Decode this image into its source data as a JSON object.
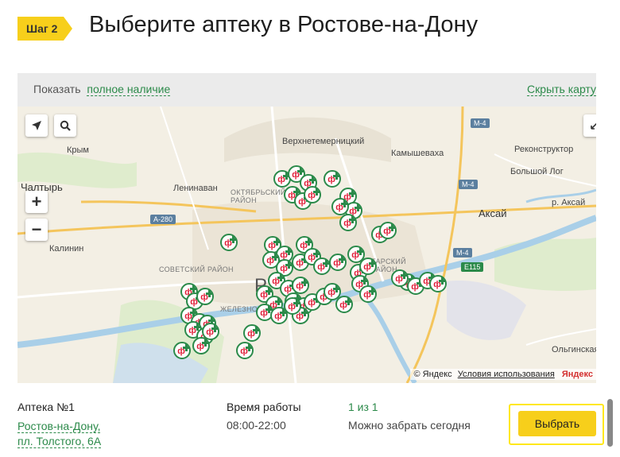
{
  "header": {
    "step_label": "Шаг 2",
    "title": "Выберите аптеку в Ростове-на-Дону"
  },
  "mapbar": {
    "show_label": "Показать",
    "show_link": "полное наличие",
    "hide_link": "Скрыть карту"
  },
  "map": {
    "zoom_in": "+",
    "zoom_out": "−",
    "labels": {
      "verkhnetemernitsky": "Верхнетемерницкий",
      "kamyshevakha": "Камышеваха",
      "rekonstruktor": "Реконструктор",
      "bolshoy_log": "Большой Лог",
      "krym": "Крым",
      "chaltyr": "Чалтырь",
      "leninavan": "Ленинаван",
      "oktyabrsky": "ОКТЯБРЬСКИЙ РАЙОН",
      "aksay": "Аксай",
      "r_aksay": "р. Аксай",
      "kalinin": "Калинин",
      "sovetsky": "СОВЕТСКИЙ РАЙОН",
      "zheleznodorozhny": "ЖЕЛЕЗНОДОРОЖНЫЙ",
      "proletarsky": "ПРОЛЕТАРСКИЙ РАЙОН",
      "olginskaya": "Ольгинская",
      "city": "Ростов-на-Дону"
    },
    "shields": {
      "a280": "А-280",
      "m4_top": "М-4",
      "m4_mid": "М-4",
      "m4_right": "М-4",
      "e115": "Е115"
    },
    "attribution": {
      "copyright": "© Яндекс",
      "terms": "Условия использования",
      "logo": "Яндекс"
    },
    "marker_glyph": "ф"
  },
  "pharmacy": {
    "name": "Аптека №1",
    "address_line1": "Ростов-на-Дону,",
    "address_line2": "пл. Толстого, 6А",
    "hours_title": "Время работы",
    "hours": "08:00-22:00",
    "count": "1 из 1",
    "pickup": "Можно забрать сегодня",
    "select_button": "Выбрать"
  },
  "colors": {
    "accent_yellow": "#f7cf1b",
    "link_green": "#2c8a4a",
    "marker_red": "#e0203a"
  }
}
